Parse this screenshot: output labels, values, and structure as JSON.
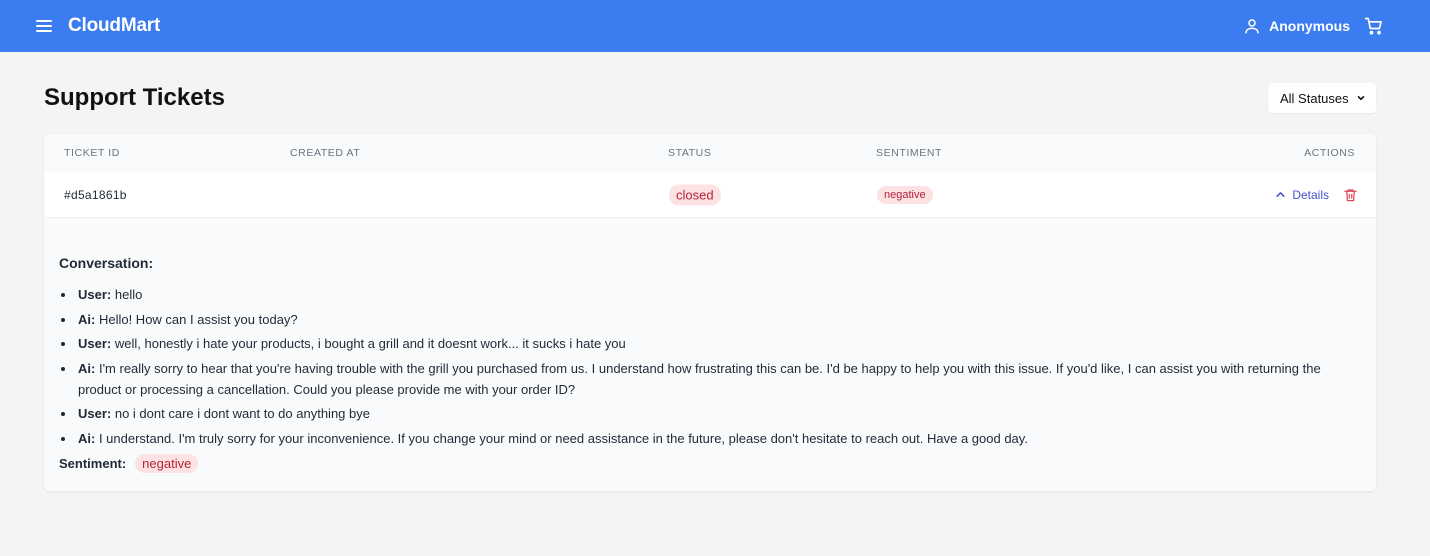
{
  "app": {
    "brand": "CloudMart"
  },
  "topbar": {
    "user_name": "Anonymous"
  },
  "page": {
    "title": "Support Tickets",
    "status_filter": "All Statuses"
  },
  "table": {
    "headers": {
      "ticket_id": "TICKET ID",
      "created_at": "CREATED AT",
      "status": "STATUS",
      "sentiment": "SENTIMENT",
      "actions": "ACTIONS"
    },
    "rows": [
      {
        "ticket_id": "#d5a1861b",
        "created_at": "",
        "status": "closed",
        "sentiment": "negative",
        "details_label": "Details"
      }
    ]
  },
  "details": {
    "conversation_title": "Conversation:",
    "messages": [
      {
        "speaker": "User:",
        "text": " hello"
      },
      {
        "speaker": "Ai:",
        "text": " Hello! How can I assist you today?"
      },
      {
        "speaker": "User:",
        "text": " well, honestly i hate your products, i bought a grill and it doesnt work... it sucks i hate you"
      },
      {
        "speaker": "Ai:",
        "text": " I'm really sorry to hear that you're having trouble with the grill you purchased from us. I understand how frustrating this can be. I'd be happy to help you with this issue. If you'd like, I can assist you with returning the product or processing a cancellation. Could you please provide me with your order ID?"
      },
      {
        "speaker": "User:",
        "text": " no i dont care i dont want to do anything bye"
      },
      {
        "speaker": "Ai:",
        "text": " I understand. I'm truly sorry for your inconvenience. If you change your mind or need assistance in the future, please don't hesitate to reach out. Have a good day."
      }
    ],
    "sentiment_label": "Sentiment:",
    "sentiment_value": "negative"
  },
  "colors": {
    "topbar": "#3b7cf0",
    "badge_bg": "#fde2e4",
    "badge_text": "#b4233a",
    "link": "#4453c7",
    "trash": "#e0465a"
  },
  "icons": {
    "menu": "hamburger-icon",
    "user": "user-icon",
    "cart": "cart-icon",
    "chevron": "chevron-up-icon",
    "dropdown": "chevron-down-icon",
    "delete": "trash-icon"
  }
}
